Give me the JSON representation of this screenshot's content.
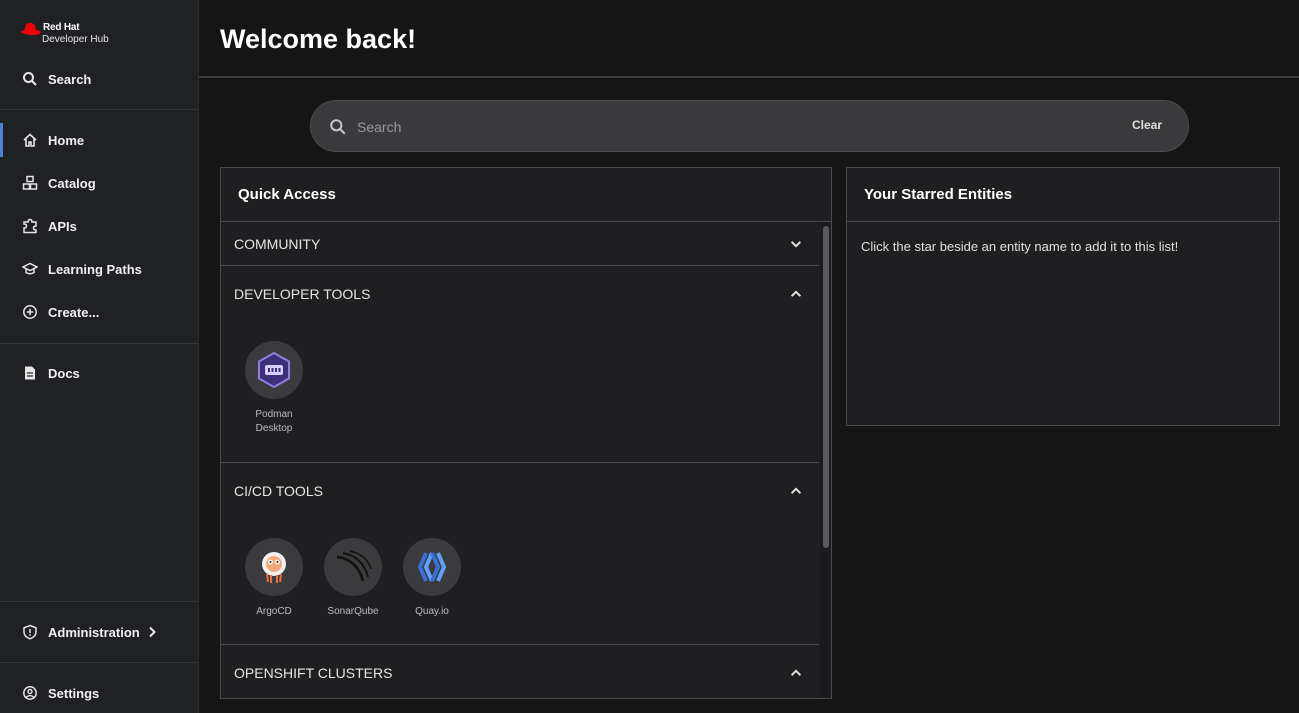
{
  "brand": {
    "line1": "Red Hat",
    "line2": "Developer Hub"
  },
  "sidebar": {
    "search_label": "Search",
    "items": [
      {
        "label": "Home",
        "icon": "home-icon",
        "active": true
      },
      {
        "label": "Catalog",
        "icon": "catalog-icon"
      },
      {
        "label": "APIs",
        "icon": "puzzle-icon"
      },
      {
        "label": "Learning Paths",
        "icon": "graduation-cap-icon"
      },
      {
        "label": "Create...",
        "icon": "plus-circle-icon"
      }
    ],
    "docs_label": "Docs",
    "admin_label": "Administration",
    "settings_label": "Settings"
  },
  "header": {
    "title": "Welcome back!"
  },
  "search": {
    "placeholder": "Search",
    "clear_label": "Clear"
  },
  "quick_access": {
    "title": "Quick Access",
    "sections": [
      {
        "label": "COMMUNITY",
        "expanded": false,
        "tools": []
      },
      {
        "label": "DEVELOPER TOOLS",
        "expanded": true,
        "tools": [
          {
            "line1": "Podman",
            "line2": "Desktop"
          }
        ]
      },
      {
        "label": "CI/CD TOOLS",
        "expanded": true,
        "tools": [
          {
            "line1": "ArgoCD"
          },
          {
            "line1": "SonarQube"
          },
          {
            "line1": "Quay.io"
          }
        ]
      },
      {
        "label": "OPENSHIFT CLUSTERS",
        "expanded": true,
        "tools": []
      }
    ]
  },
  "starred": {
    "title": "Your Starred Entities",
    "empty_message": "Click the star beside an entity name to add it to this list!"
  },
  "colors": {
    "accent": "#4b83d6",
    "brand_red": "#ee0000",
    "background": "#151515"
  }
}
